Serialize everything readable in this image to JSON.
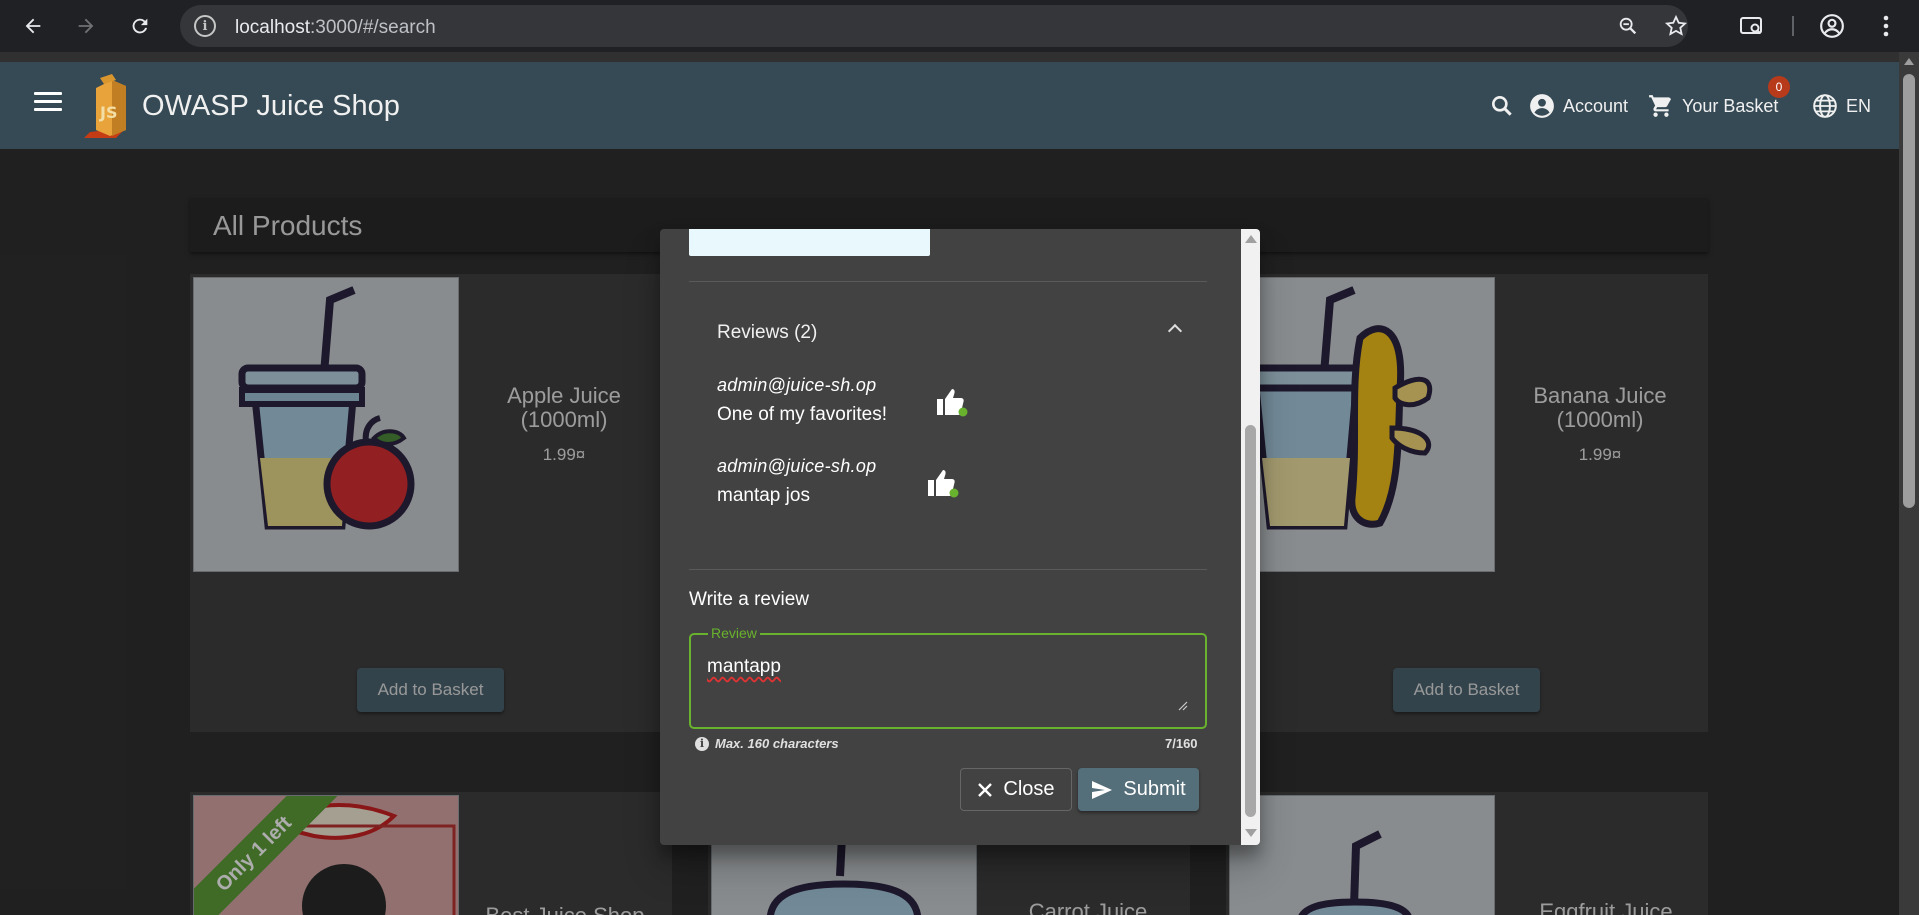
{
  "browser": {
    "url_host": "localhost",
    "url_rest": ":3000/#/search"
  },
  "toolbar": {
    "title": "OWASP Juice Shop",
    "account_label": "Account",
    "basket_label": "Your Basket",
    "basket_count": "0",
    "language_label": "EN",
    "logo_text": "JS"
  },
  "main": {
    "heading": "All Products",
    "add_to_basket_label": "Add to Basket",
    "products": [
      {
        "name": "Apple Juice (1000ml)",
        "price": "1.99¤"
      },
      {
        "name": "Banana Juice (1000ml)",
        "price": "1.99¤"
      },
      {
        "name": "Best Juice Shop",
        "badge": "Only 1 left"
      },
      {
        "name": "Carrot Juice"
      },
      {
        "name": "Eggfruit Juice"
      }
    ]
  },
  "dialog": {
    "reviews_header": "Reviews (2)",
    "reviews": [
      {
        "author": "admin@juice-sh.op",
        "text": "One of my favorites!"
      },
      {
        "author": "admin@juice-sh.op",
        "text": "mantap jos"
      }
    ],
    "write_title": "Write a review",
    "review_label": "Review",
    "review_value": "mantapp",
    "hint": "Max. 160 characters",
    "counter": "7/160",
    "close_label": "Close",
    "submit_label": "Submit"
  },
  "colors": {
    "toolbar_bg": "#354a55",
    "accent_green": "#69b22d",
    "badge_red": "#b73a1b",
    "submit_bg": "#546e7a"
  }
}
